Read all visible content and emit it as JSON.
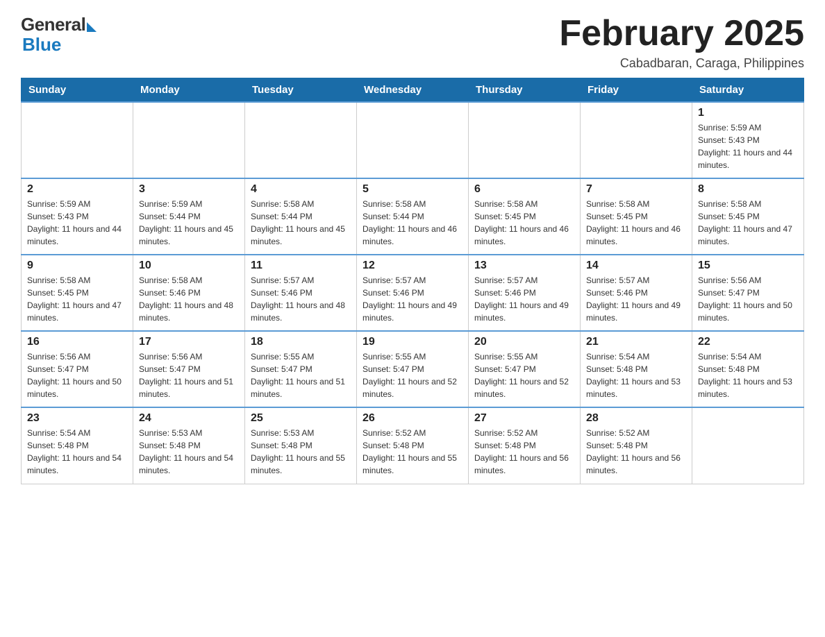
{
  "header": {
    "logo_general": "General",
    "logo_blue": "Blue",
    "month_title": "February 2025",
    "location": "Cabadbaran, Caraga, Philippines"
  },
  "days_of_week": [
    "Sunday",
    "Monday",
    "Tuesday",
    "Wednesday",
    "Thursday",
    "Friday",
    "Saturday"
  ],
  "weeks": [
    {
      "days": [
        {
          "num": "",
          "sunrise": "",
          "sunset": "",
          "daylight": "",
          "empty": true
        },
        {
          "num": "",
          "sunrise": "",
          "sunset": "",
          "daylight": "",
          "empty": true
        },
        {
          "num": "",
          "sunrise": "",
          "sunset": "",
          "daylight": "",
          "empty": true
        },
        {
          "num": "",
          "sunrise": "",
          "sunset": "",
          "daylight": "",
          "empty": true
        },
        {
          "num": "",
          "sunrise": "",
          "sunset": "",
          "daylight": "",
          "empty": true
        },
        {
          "num": "",
          "sunrise": "",
          "sunset": "",
          "daylight": "",
          "empty": true
        },
        {
          "num": "1",
          "sunrise": "Sunrise: 5:59 AM",
          "sunset": "Sunset: 5:43 PM",
          "daylight": "Daylight: 11 hours and 44 minutes.",
          "empty": false
        }
      ]
    },
    {
      "days": [
        {
          "num": "2",
          "sunrise": "Sunrise: 5:59 AM",
          "sunset": "Sunset: 5:43 PM",
          "daylight": "Daylight: 11 hours and 44 minutes.",
          "empty": false
        },
        {
          "num": "3",
          "sunrise": "Sunrise: 5:59 AM",
          "sunset": "Sunset: 5:44 PM",
          "daylight": "Daylight: 11 hours and 45 minutes.",
          "empty": false
        },
        {
          "num": "4",
          "sunrise": "Sunrise: 5:58 AM",
          "sunset": "Sunset: 5:44 PM",
          "daylight": "Daylight: 11 hours and 45 minutes.",
          "empty": false
        },
        {
          "num": "5",
          "sunrise": "Sunrise: 5:58 AM",
          "sunset": "Sunset: 5:44 PM",
          "daylight": "Daylight: 11 hours and 46 minutes.",
          "empty": false
        },
        {
          "num": "6",
          "sunrise": "Sunrise: 5:58 AM",
          "sunset": "Sunset: 5:45 PM",
          "daylight": "Daylight: 11 hours and 46 minutes.",
          "empty": false
        },
        {
          "num": "7",
          "sunrise": "Sunrise: 5:58 AM",
          "sunset": "Sunset: 5:45 PM",
          "daylight": "Daylight: 11 hours and 46 minutes.",
          "empty": false
        },
        {
          "num": "8",
          "sunrise": "Sunrise: 5:58 AM",
          "sunset": "Sunset: 5:45 PM",
          "daylight": "Daylight: 11 hours and 47 minutes.",
          "empty": false
        }
      ]
    },
    {
      "days": [
        {
          "num": "9",
          "sunrise": "Sunrise: 5:58 AM",
          "sunset": "Sunset: 5:45 PM",
          "daylight": "Daylight: 11 hours and 47 minutes.",
          "empty": false
        },
        {
          "num": "10",
          "sunrise": "Sunrise: 5:58 AM",
          "sunset": "Sunset: 5:46 PM",
          "daylight": "Daylight: 11 hours and 48 minutes.",
          "empty": false
        },
        {
          "num": "11",
          "sunrise": "Sunrise: 5:57 AM",
          "sunset": "Sunset: 5:46 PM",
          "daylight": "Daylight: 11 hours and 48 minutes.",
          "empty": false
        },
        {
          "num": "12",
          "sunrise": "Sunrise: 5:57 AM",
          "sunset": "Sunset: 5:46 PM",
          "daylight": "Daylight: 11 hours and 49 minutes.",
          "empty": false
        },
        {
          "num": "13",
          "sunrise": "Sunrise: 5:57 AM",
          "sunset": "Sunset: 5:46 PM",
          "daylight": "Daylight: 11 hours and 49 minutes.",
          "empty": false
        },
        {
          "num": "14",
          "sunrise": "Sunrise: 5:57 AM",
          "sunset": "Sunset: 5:46 PM",
          "daylight": "Daylight: 11 hours and 49 minutes.",
          "empty": false
        },
        {
          "num": "15",
          "sunrise": "Sunrise: 5:56 AM",
          "sunset": "Sunset: 5:47 PM",
          "daylight": "Daylight: 11 hours and 50 minutes.",
          "empty": false
        }
      ]
    },
    {
      "days": [
        {
          "num": "16",
          "sunrise": "Sunrise: 5:56 AM",
          "sunset": "Sunset: 5:47 PM",
          "daylight": "Daylight: 11 hours and 50 minutes.",
          "empty": false
        },
        {
          "num": "17",
          "sunrise": "Sunrise: 5:56 AM",
          "sunset": "Sunset: 5:47 PM",
          "daylight": "Daylight: 11 hours and 51 minutes.",
          "empty": false
        },
        {
          "num": "18",
          "sunrise": "Sunrise: 5:55 AM",
          "sunset": "Sunset: 5:47 PM",
          "daylight": "Daylight: 11 hours and 51 minutes.",
          "empty": false
        },
        {
          "num": "19",
          "sunrise": "Sunrise: 5:55 AM",
          "sunset": "Sunset: 5:47 PM",
          "daylight": "Daylight: 11 hours and 52 minutes.",
          "empty": false
        },
        {
          "num": "20",
          "sunrise": "Sunrise: 5:55 AM",
          "sunset": "Sunset: 5:47 PM",
          "daylight": "Daylight: 11 hours and 52 minutes.",
          "empty": false
        },
        {
          "num": "21",
          "sunrise": "Sunrise: 5:54 AM",
          "sunset": "Sunset: 5:48 PM",
          "daylight": "Daylight: 11 hours and 53 minutes.",
          "empty": false
        },
        {
          "num": "22",
          "sunrise": "Sunrise: 5:54 AM",
          "sunset": "Sunset: 5:48 PM",
          "daylight": "Daylight: 11 hours and 53 minutes.",
          "empty": false
        }
      ]
    },
    {
      "days": [
        {
          "num": "23",
          "sunrise": "Sunrise: 5:54 AM",
          "sunset": "Sunset: 5:48 PM",
          "daylight": "Daylight: 11 hours and 54 minutes.",
          "empty": false
        },
        {
          "num": "24",
          "sunrise": "Sunrise: 5:53 AM",
          "sunset": "Sunset: 5:48 PM",
          "daylight": "Daylight: 11 hours and 54 minutes.",
          "empty": false
        },
        {
          "num": "25",
          "sunrise": "Sunrise: 5:53 AM",
          "sunset": "Sunset: 5:48 PM",
          "daylight": "Daylight: 11 hours and 55 minutes.",
          "empty": false
        },
        {
          "num": "26",
          "sunrise": "Sunrise: 5:52 AM",
          "sunset": "Sunset: 5:48 PM",
          "daylight": "Daylight: 11 hours and 55 minutes.",
          "empty": false
        },
        {
          "num": "27",
          "sunrise": "Sunrise: 5:52 AM",
          "sunset": "Sunset: 5:48 PM",
          "daylight": "Daylight: 11 hours and 56 minutes.",
          "empty": false
        },
        {
          "num": "28",
          "sunrise": "Sunrise: 5:52 AM",
          "sunset": "Sunset: 5:48 PM",
          "daylight": "Daylight: 11 hours and 56 minutes.",
          "empty": false
        },
        {
          "num": "",
          "sunrise": "",
          "sunset": "",
          "daylight": "",
          "empty": true
        }
      ]
    }
  ]
}
